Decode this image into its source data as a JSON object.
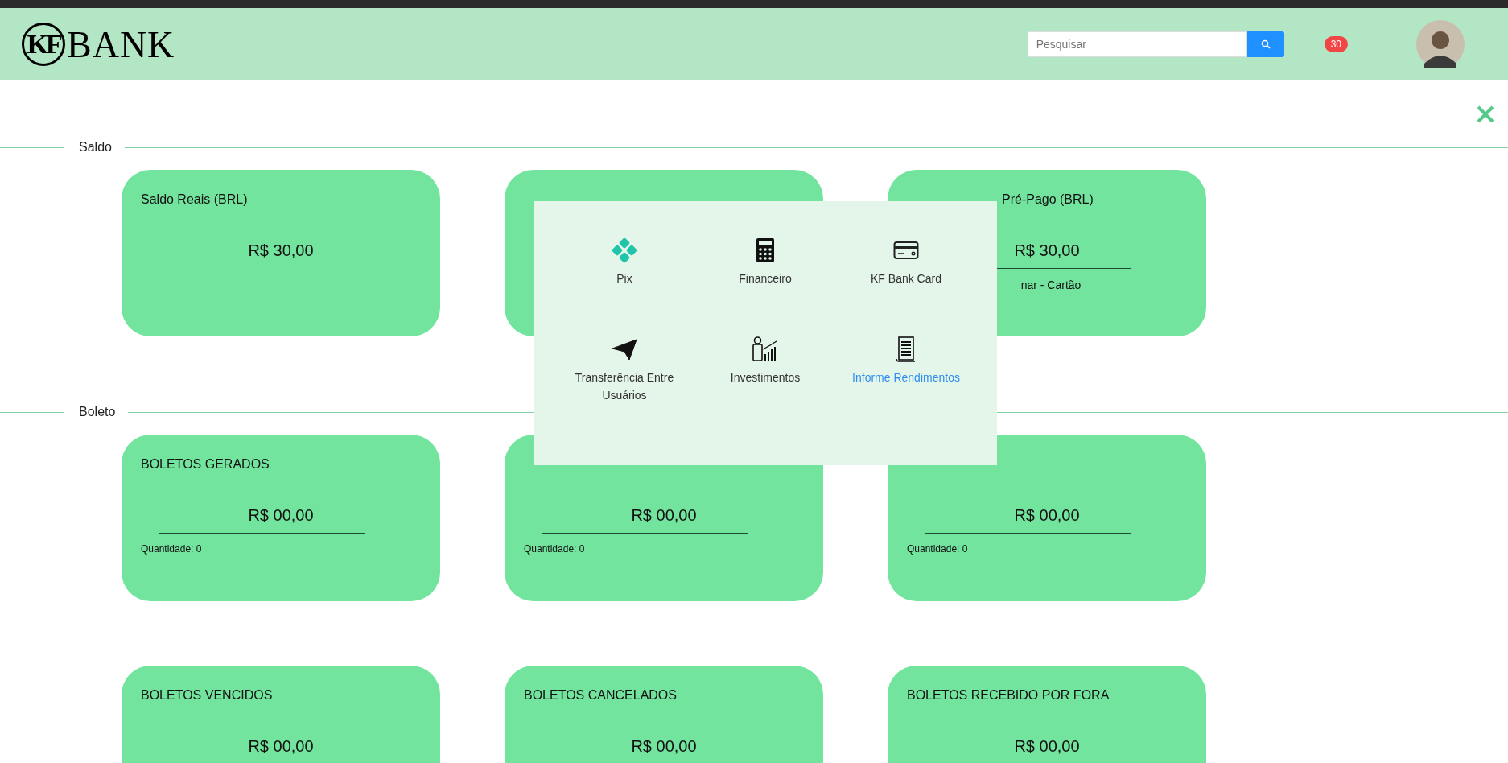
{
  "header": {
    "logo": {
      "monogram": "KF",
      "wordmark": "BANK"
    },
    "search": {
      "placeholder": "Pesquisar"
    },
    "notification_count": "30"
  },
  "sections": [
    {
      "title": "Saldo",
      "cards": [
        {
          "title": "Saldo Reais (BRL)",
          "amount": "R$ 30,00",
          "underline": false
        },
        {
          "underline": false
        },
        {
          "kind": "balance",
          "title": "Pré-Pago (BRL)",
          "partial": true,
          "amount": "R$ 30,00",
          "underline": true,
          "caption": "nar - Cartão"
        }
      ]
    },
    {
      "title": "Boleto",
      "cards": [
        {
          "kind": "count",
          "title": "BOLETOS GERADOS",
          "amount": "R$ 00,00",
          "underline": true,
          "caption": "Quantidade: 0"
        },
        {
          "kind": "count",
          "amount": "R$ 00,00",
          "underline": true,
          "caption": "Quantidade: 0"
        },
        {
          "kind": "count",
          "amount": "R$ 00,00",
          "underline": true,
          "caption": "Quantidade: 0"
        },
        {
          "title": "BOLETOS VENCIDOS",
          "amount": "R$ 00,00",
          "underline": false
        },
        {
          "title": "BOLETOS CANCELADOS",
          "amount": "R$ 00,00",
          "underline": false
        },
        {
          "title": "BOLETOS RECEBIDO POR FORA",
          "amount": "R$ 00,00",
          "underline": false
        }
      ]
    }
  ],
  "menu": {
    "items": [
      {
        "kind": "pix",
        "label": "Pix",
        "selected": false
      },
      {
        "kind": "calculator",
        "label": "Financeiro",
        "selected": false
      },
      {
        "kind": "card",
        "label": "KF Bank Card",
        "selected": false
      },
      {
        "kind": "plane",
        "label": "Transferência Entre Usuários",
        "selected": false
      },
      {
        "kind": "growth",
        "label": "Investimentos",
        "selected": false
      },
      {
        "kind": "document",
        "label": "Informe Rendimentos",
        "selected": true
      }
    ]
  }
}
